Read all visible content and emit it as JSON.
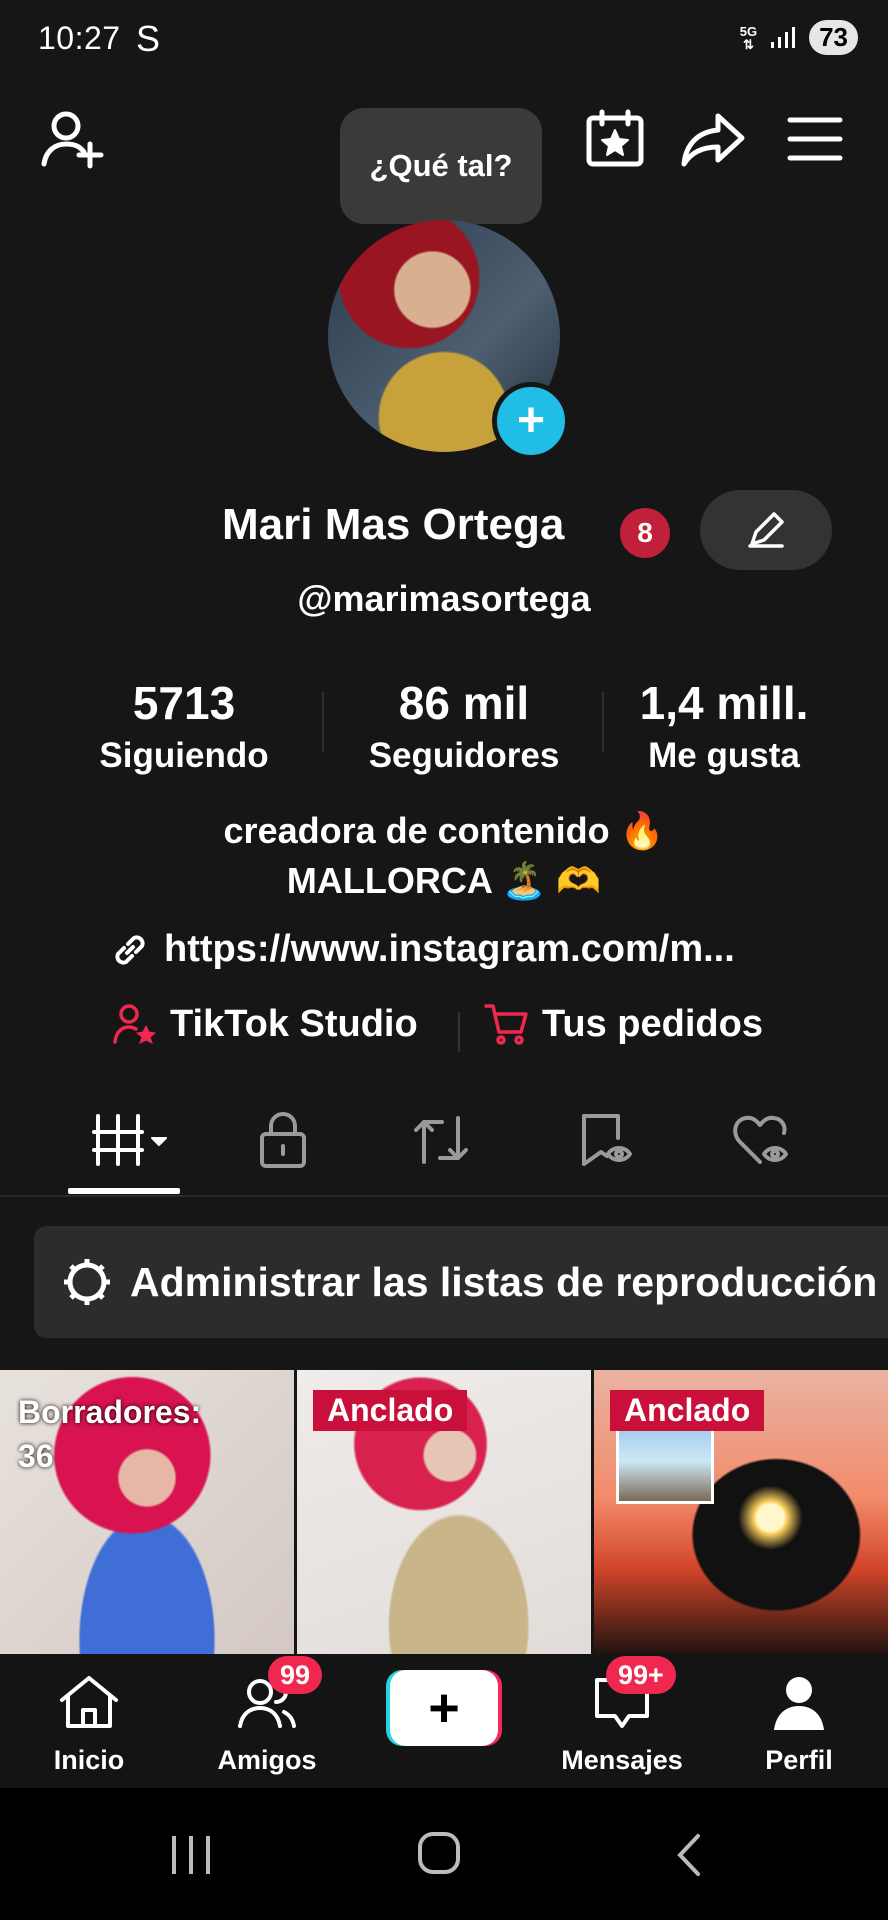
{
  "status": {
    "time": "10:27",
    "app_icon": "S",
    "network": "5G",
    "battery": "73"
  },
  "header": {
    "tooltip": "¿Qué tal?"
  },
  "profile": {
    "name": "Mari Mas Ortega",
    "badge_count": "8",
    "handle": "@marimasortega",
    "stats": [
      {
        "value": "5713",
        "label": "Siguiendo"
      },
      {
        "value": "86 mil",
        "label": "Seguidores"
      },
      {
        "value": "1,4 mill.",
        "label": "Me gusta"
      }
    ],
    "bio_line1": "creadora de contenido 🔥",
    "bio_line2": "MALLORCA 🏝️ 🫶",
    "link": "https://www.instagram.com/m...",
    "tool1": "TikTok Studio",
    "tool2": "Tus pedidos"
  },
  "manage": {
    "label": "Administrar las listas de reproducción"
  },
  "grid": {
    "item1_label": "Borradores:",
    "item1_count": "36",
    "item2_tag": "Anclado",
    "item3_tag": "Anclado"
  },
  "nav": {
    "home": "Inicio",
    "friends": "Amigos",
    "friends_badge": "99",
    "messages": "Mensajes",
    "messages_badge": "99+",
    "profile": "Perfil",
    "create_symbol": "+"
  },
  "colors": {
    "background": "#161616",
    "accent_red": "#c8103a",
    "badge": "#f02850",
    "avatar_plus": "#20bde6"
  }
}
